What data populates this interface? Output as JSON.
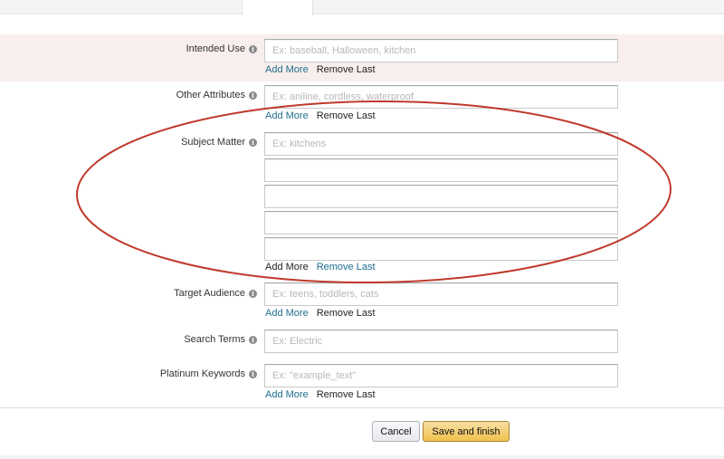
{
  "form": {
    "rows": [
      {
        "label": "Intended Use",
        "fields": [
          {
            "placeholder": "Ex: baseball, Halloween, kitchen"
          }
        ],
        "add_more": "Add More",
        "remove_last": "Remove Last"
      },
      {
        "label": "Other Attributes",
        "fields": [
          {
            "placeholder": "Ex: aniline, cordless, waterproof"
          }
        ],
        "add_more": "Add More",
        "remove_last": "Remove Last"
      },
      {
        "label": "Subject Matter",
        "fields": [
          {
            "placeholder": "Ex: kitchens"
          },
          {
            "placeholder": ""
          },
          {
            "placeholder": ""
          },
          {
            "placeholder": ""
          },
          {
            "placeholder": ""
          }
        ],
        "add_more": "Add More",
        "remove_last": "Remove Last"
      },
      {
        "label": "Target Audience",
        "fields": [
          {
            "placeholder": "Ex: teens, toddlers, cats"
          }
        ],
        "add_more": "Add More",
        "remove_last": "Remove Last"
      },
      {
        "label": "Search Terms",
        "fields": [
          {
            "placeholder": "Ex: Electric"
          }
        ]
      },
      {
        "label": "Platinum Keywords",
        "fields": [
          {
            "placeholder": "Ex: \"example_text\""
          }
        ],
        "add_more": "Add More",
        "remove_last": "Remove Last"
      }
    ],
    "info_icon_glyph": "i"
  },
  "actions": {
    "cancel_label": "Cancel",
    "save_label": "Save and finish"
  },
  "colors": {
    "link": "#1f6e8c",
    "highlight_band": "#f8eeee",
    "primary_button": "#f0c14b",
    "annotation_ellipse": "#c0392b"
  }
}
